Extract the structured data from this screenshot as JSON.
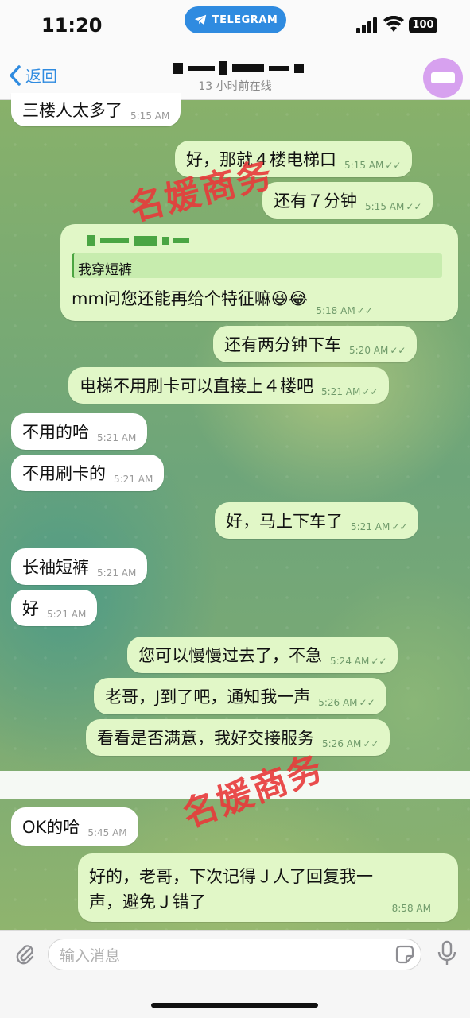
{
  "status_bar": {
    "time": "11:20",
    "app_pill": "TELEGRAM",
    "battery": "100"
  },
  "header": {
    "back_label": "返回",
    "status": "13 小时前在线"
  },
  "messages": [
    {
      "text": "三楼人太多了",
      "time": "5:15 AM",
      "dir": "in"
    },
    {
      "text": "好，那就４楼电梯口",
      "time": "5:15 AM",
      "dir": "out"
    },
    {
      "text": "还有７分钟",
      "time": "5:15 AM",
      "dir": "out"
    },
    {
      "text": "mm问您还能再给个特征嘛😆😂",
      "time": "5:18 AM",
      "dir": "out",
      "quote": "我穿短裤"
    },
    {
      "text": "还有两分钟下车",
      "time": "5:20 AM",
      "dir": "out"
    },
    {
      "text": "电梯不用刷卡可以直接上４楼吧",
      "time": "5:21 AM",
      "dir": "out"
    },
    {
      "text": "不用的哈",
      "time": "5:21 AM",
      "dir": "in"
    },
    {
      "text": "不用刷卡的",
      "time": "5:21 AM",
      "dir": "in"
    },
    {
      "text": "好，马上下车了",
      "time": "5:21 AM",
      "dir": "out"
    },
    {
      "text": "长袖短裤",
      "time": "5:21 AM",
      "dir": "in"
    },
    {
      "text": "好",
      "time": "5:21 AM",
      "dir": "in"
    },
    {
      "text": "您可以慢慢过去了，不急",
      "time": "5:24 AM",
      "dir": "out"
    },
    {
      "text": "老哥，J到了吧，通知我一声",
      "time": "5:26 AM",
      "dir": "out"
    },
    {
      "text": "看看是否满意，我好交接服务",
      "time": "5:26 AM",
      "dir": "out"
    },
    {
      "text": "OK的哈",
      "time": "5:45 AM",
      "dir": "in"
    },
    {
      "text_line1": "好的，老哥，下次记得Ｊ人了回复我一",
      "text_line2": "声，避免Ｊ错了",
      "time": "8:58 AM",
      "dir": "out"
    }
  ],
  "watermark": "名媛商务",
  "input": {
    "placeholder": "输入消息"
  },
  "icons": {
    "back": "chevron-left-icon",
    "attach": "paperclip-icon",
    "sticker": "sticker-icon",
    "mic": "microphone-icon",
    "checks": "double-check-icon"
  },
  "colors": {
    "accent": "#2f8be0",
    "outgoing_bubble": "#e1f7c7",
    "incoming_bubble": "#ffffff",
    "watermark": "#e83a3a"
  }
}
